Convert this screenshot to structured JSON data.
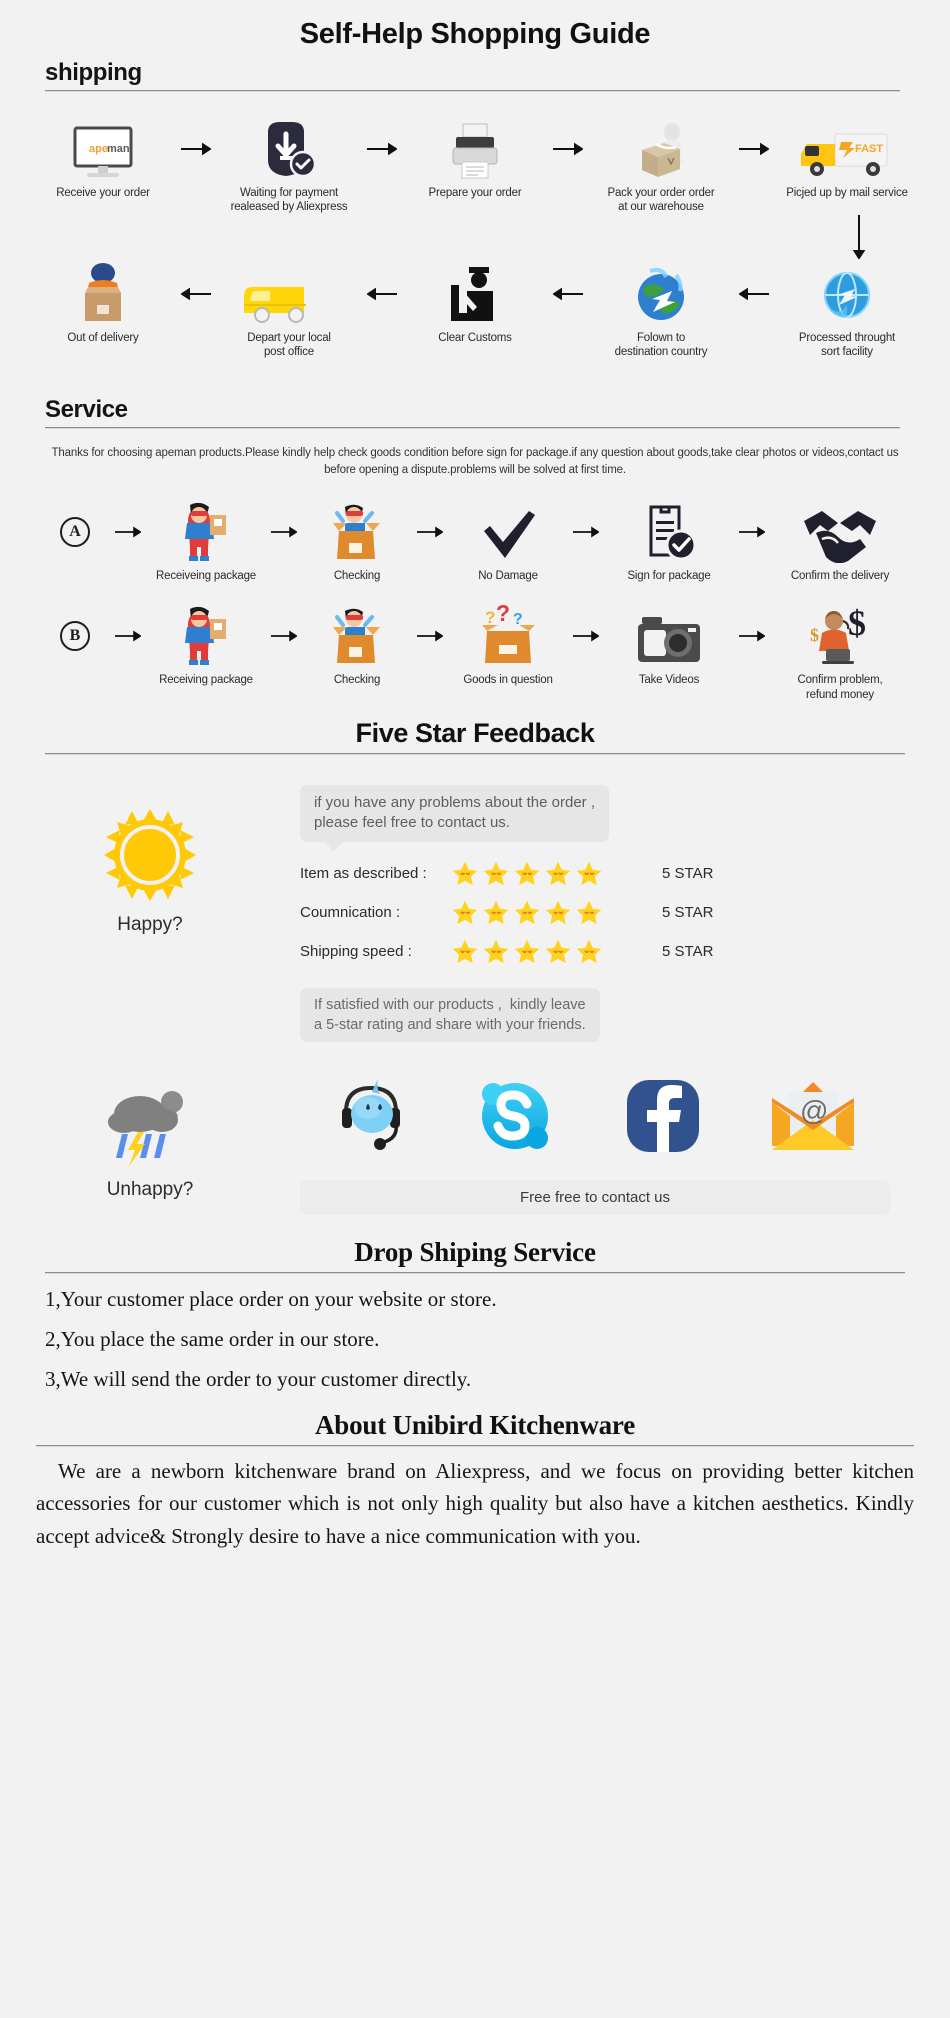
{
  "page": {
    "title": "Self-Help Shopping Guide",
    "background": "#f2f2f2"
  },
  "shipping": {
    "heading": "shipping",
    "row1": [
      {
        "icon": "monitor-apeman-icon",
        "caption": "Receive your order"
      },
      {
        "icon": "payment-shield-dollar-icon",
        "caption": "Waiting for payment\nrealeased by Aliexpress"
      },
      {
        "icon": "printer-icon",
        "caption": "Prepare your order"
      },
      {
        "icon": "worker-packing-box-icon",
        "caption": "Pack your order order\nat our warehouse"
      },
      {
        "icon": "fast-delivery-truck-icon",
        "caption": "Picjed up by mail service"
      }
    ],
    "row2": [
      {
        "icon": "delivery-man-box-icon",
        "caption": "Out of delivery"
      },
      {
        "icon": "yellow-van-icon",
        "caption": "Depart your local\npost office"
      },
      {
        "icon": "customs-officer-icon",
        "caption": "Clear Customs"
      },
      {
        "icon": "globe-airplane-icon",
        "caption": "Folown to\ndestination country"
      },
      {
        "icon": "blue-globe-sort-icon",
        "caption": "Processed throught\nsort facility"
      }
    ]
  },
  "service": {
    "heading": "Service",
    "note": "Thanks for choosing apeman products.Please kindly help check goods condition before sign for package.if any question about goods,take clear photos or videos,contact us before opening a dispute.problems will be solved at first time.",
    "rowA": {
      "badge": "A",
      "steps": [
        {
          "icon": "superhero-holding-parcel-icon",
          "caption": "Receiveing package"
        },
        {
          "icon": "person-in-open-box-icon",
          "caption": "Checking"
        },
        {
          "icon": "checkmark-icon",
          "caption": "No Damage"
        },
        {
          "icon": "signed-document-check-icon",
          "caption": "Sign for package"
        },
        {
          "icon": "handshake-icon",
          "caption": "Confirm the delivery"
        }
      ]
    },
    "rowB": {
      "badge": "B",
      "steps": [
        {
          "icon": "superhero-holding-parcel-icon",
          "caption": "Receiving package"
        },
        {
          "icon": "person-in-open-box-icon",
          "caption": "Checking"
        },
        {
          "icon": "box-with-question-marks-icon",
          "caption": "Goods in question"
        },
        {
          "icon": "camera-icon",
          "caption": "Take Videos"
        },
        {
          "icon": "support-agent-dollar-icon",
          "caption": "Confirm problem,\nrefund money"
        }
      ]
    }
  },
  "feedback": {
    "heading": "Five Star Feedback",
    "happy_icon": "sun-icon",
    "happy_label": "Happy?",
    "bubble_top": "if you have any problems about the order ,\nplease feel free to contact us.",
    "ratings": [
      {
        "label": "Item as described :",
        "stars": 5,
        "value": "5 STAR"
      },
      {
        "label": "Coumnication :",
        "stars": 5,
        "value": "5 STAR"
      },
      {
        "label": "Shipping speed :",
        "stars": 5,
        "value": "5 STAR"
      }
    ],
    "bubble_bottom": "If satisfied with our products ,  kindly leave\na 5-star rating and share with your friends.",
    "unhappy_icon": "rain-cloud-icon",
    "unhappy_label": "Unhappy?",
    "contact_icons": [
      {
        "name": "trademanager-headset-icon"
      },
      {
        "name": "skype-icon"
      },
      {
        "name": "facebook-icon"
      },
      {
        "name": "email-envelope-icon"
      }
    ],
    "contact_bar": "Free free to contact us",
    "star_color": "#ffd21e"
  },
  "dropship": {
    "heading": "Drop Shiping Service",
    "lines": [
      "1,Your customer place order on your website or store.",
      "2,You place the same order in our store.",
      "3,We will send the order to your customer directly."
    ]
  },
  "about": {
    "heading": "About Unibird Kitchenware",
    "text": "We are a newborn kitchenware brand on Aliexpress, and we focus on providing better kitchen accessories for our customer which is not only high quality but also have a kitchen aesthetics. Kindly accept advice& Strongly desire to have a nice communication with you."
  }
}
